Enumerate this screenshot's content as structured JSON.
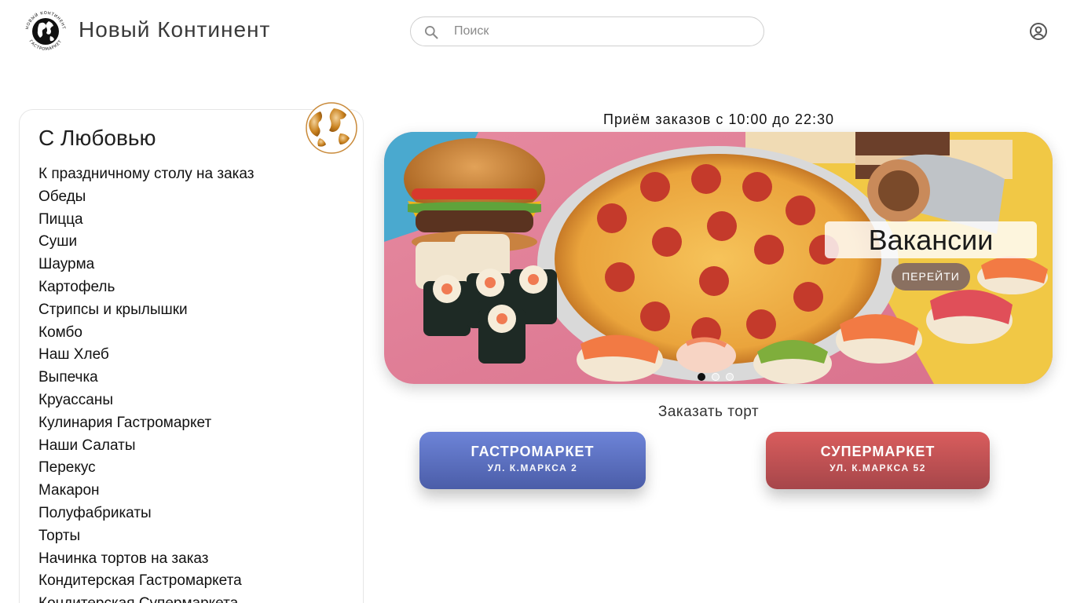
{
  "header": {
    "brand": "Новый Континент",
    "logo_text_top": "НОВЫЙ КОНТИНЕНТ",
    "logo_text_bottom": "ГАСТРОМАРКЕТ",
    "search_placeholder": "Поиск",
    "search_value": "",
    "icons": {
      "logo": "globe-logo-icon",
      "search": "search-icon",
      "account": "account-circle-icon"
    }
  },
  "sidebar": {
    "title": "С Любовью",
    "items": [
      "К праздничному столу на заказ",
      "Обеды",
      "Пицца",
      "Суши",
      "Шаурма",
      "Картофель",
      "Стрипсы и крылышки",
      "Комбо",
      "Наш Хлеб",
      "Выпечка",
      "Круассаны",
      "Кулинария Гастромаркет",
      "Наши Салаты",
      "Перекус",
      "Макарон",
      "Полуфабрикаты",
      "Торты",
      "Начинка тортов на заказ",
      "Кондитерская Гастромаркета",
      "Кондитерская Супермаркета"
    ]
  },
  "main": {
    "hours": "Приём заказов с 10:00 до 22:30",
    "banner": {
      "title": "Вакансии",
      "button": "ПЕРЕЙТИ",
      "slides": 3,
      "active_slide": 1
    },
    "order_cake_label": "Заказать торт",
    "stores": [
      {
        "name": "ГАСТРОМАРКЕТ",
        "address": "УЛ. К.МАРКСА 2",
        "color": "#5a6fc4"
      },
      {
        "name": "СУПЕРМАРКЕТ",
        "address": "УЛ. К.МАРКСА 52",
        "color": "#c25356"
      }
    ]
  }
}
